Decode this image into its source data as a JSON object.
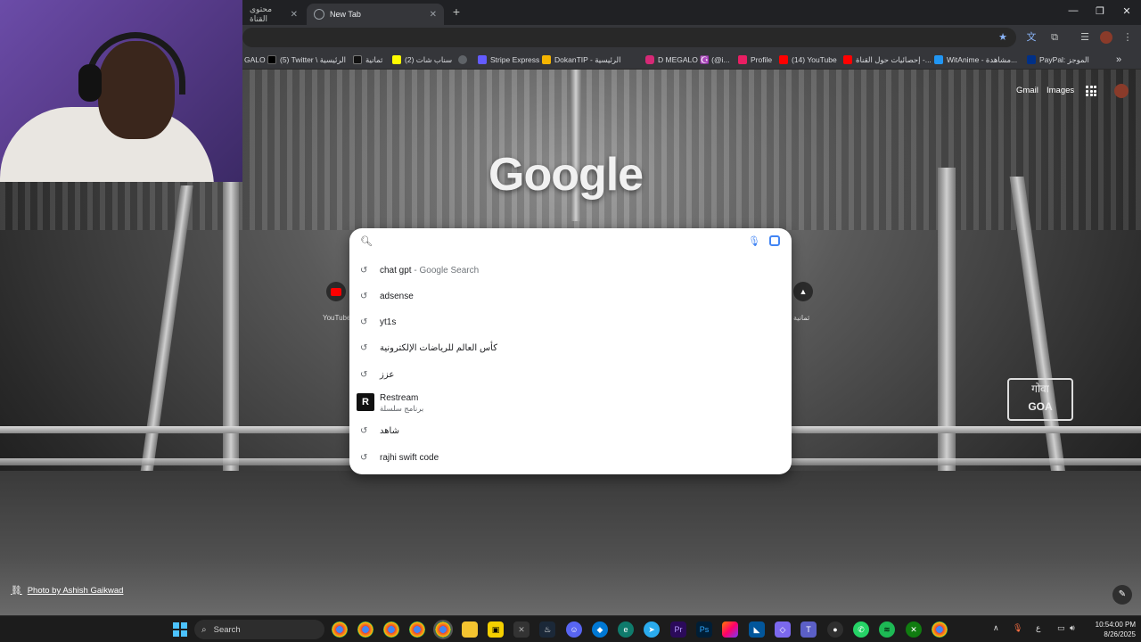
{
  "tabs": [
    {
      "label": "محتوى القناة",
      "active": false
    },
    {
      "label": "New Tab",
      "active": true
    }
  ],
  "bookmarks": [
    {
      "label": "GALO",
      "color": "#7e57c2"
    },
    {
      "label": "(5) Twitter \\ الرئيسية",
      "color": "#000000"
    },
    {
      "label": "ثمانية",
      "color": "#111111"
    },
    {
      "label": "سناب شات (2)",
      "color": "#fffc00"
    },
    {
      "label": "",
      "color": "#5f6368"
    },
    {
      "label": "Stripe Express",
      "color": "#635bff"
    },
    {
      "label": "DokanTIP - الرئيسية",
      "color": "#f4b400"
    },
    {
      "label": "D MEGALO ☪️ (@i...",
      "color": "#d62976"
    },
    {
      "label": "Profile",
      "color": "#e91e63"
    },
    {
      "label": "(14) YouTube",
      "color": "#ff0000"
    },
    {
      "label": "إحصائيات حول القناة -...",
      "color": "#ff0000"
    },
    {
      "label": "WitAnime - مشاهدة...",
      "color": "#2196f3"
    },
    {
      "label": "PayPal: الموجز",
      "color": "#003087"
    }
  ],
  "header_links": {
    "gmail": "Gmail",
    "images": "Images"
  },
  "logo_text": "Google",
  "search": {
    "value": "",
    "suggestions": [
      {
        "text": "chat gpt",
        "sub": " - Google Search",
        "type": "history"
      },
      {
        "text": "adsense",
        "sub": "",
        "type": "history"
      },
      {
        "text": "yt1s",
        "sub": "",
        "type": "history"
      },
      {
        "text": "كأس العالم للرياضات الإلكترونية",
        "sub": "",
        "type": "history"
      },
      {
        "text": "عزز",
        "sub": "",
        "type": "history"
      },
      {
        "text": "Restream",
        "sub": "برنامج سلسلة",
        "type": "entity",
        "logo": "R"
      },
      {
        "text": "شاهد",
        "sub": "",
        "type": "history"
      },
      {
        "text": "rajhi swift code",
        "sub": "",
        "type": "history"
      }
    ]
  },
  "shortcuts": [
    {
      "label": "YouTube",
      "icon": "youtube-icon",
      "color": "#ff0000"
    },
    {
      "label": "ثمانية",
      "icon": "thmanyah-icon",
      "color": "#ffffff"
    }
  ],
  "photo_credit": "Photo by Ashish Gaikwad",
  "background_sign_text": {
    "left": "गोवा",
    "right": "GOA"
  },
  "taskbar": {
    "search_label": "Search",
    "lang": "ع",
    "time": "10:54:00 PM",
    "date": "8/26/2025"
  },
  "colors": {
    "accent_blue": "#4285f4",
    "youtube_red": "#ff0000",
    "windows_blue": "#4cc2ff"
  }
}
